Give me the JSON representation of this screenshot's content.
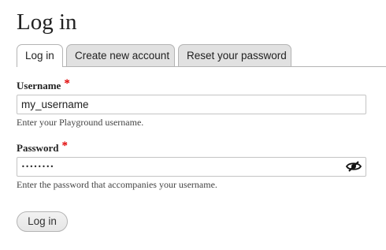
{
  "page": {
    "title": "Log in"
  },
  "tabs": [
    {
      "label": "Log in",
      "active": true
    },
    {
      "label": "Create new account",
      "active": false
    },
    {
      "label": "Reset your password",
      "active": false
    }
  ],
  "username": {
    "label": "Username",
    "required_marker": "*",
    "value": "my_username",
    "description": "Enter your Playground username."
  },
  "password": {
    "label": "Password",
    "required_marker": "*",
    "masked_value": "••••••••",
    "toggle_icon": "eye-slash-icon",
    "description": "Enter the password that accompanies your username."
  },
  "submit": {
    "label": "Log in"
  },
  "colors": {
    "required": "#e00000",
    "tab_inactive_bg": "#e1e1e1",
    "border": "#b4b4b4",
    "text": "#222222"
  }
}
